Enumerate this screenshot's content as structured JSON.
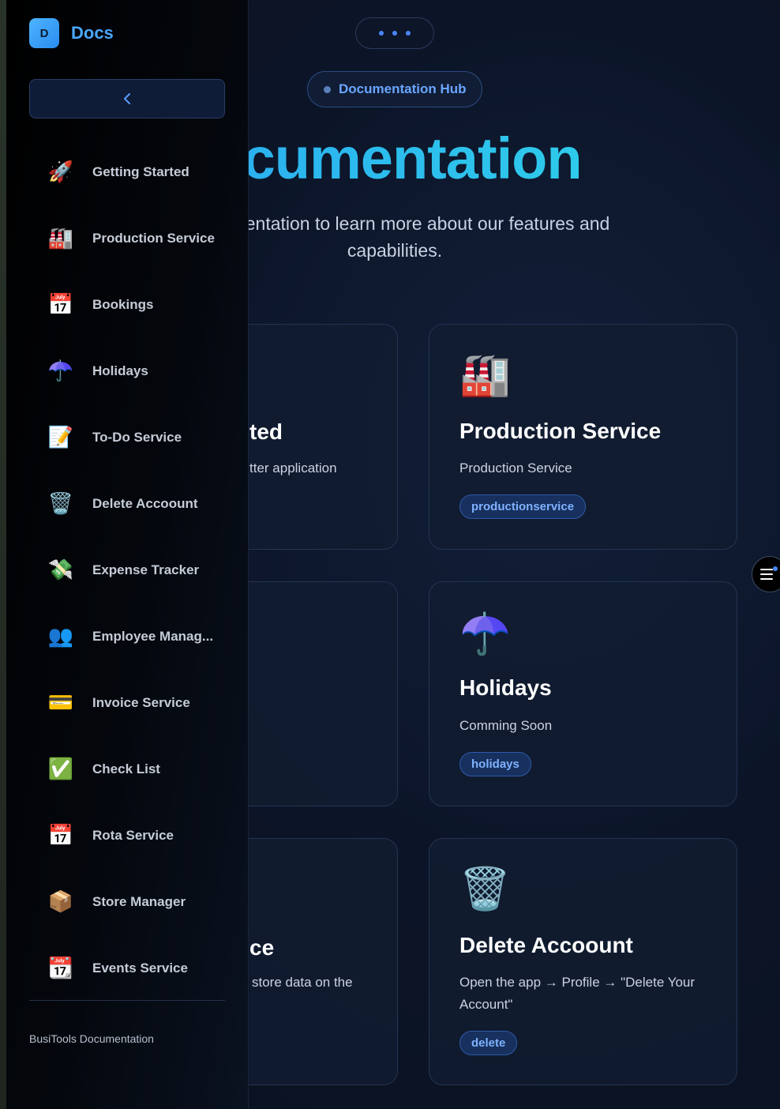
{
  "header": {
    "badge_label": "Documentation Hub",
    "hero_title_fragment": "ocumentation",
    "hero_subtitle_line1": "r documentation to learn more about our features and",
    "hero_subtitle_line2": "capabilities."
  },
  "sidebar": {
    "brand_initial": "D",
    "brand_name": "Docs",
    "items": [
      {
        "icon": "🚀",
        "icon_name": "rocket-icon",
        "label": "Getting Started"
      },
      {
        "icon": "🏭",
        "icon_name": "factory-icon",
        "label": "Production Service"
      },
      {
        "icon": "📅",
        "icon_name": "calendar-icon",
        "label": "Bookings"
      },
      {
        "icon": "☂️",
        "icon_name": "umbrella-icon",
        "label": "Holidays"
      },
      {
        "icon": "📝",
        "icon_name": "memo-icon",
        "label": "To-Do Service"
      },
      {
        "icon": "🗑️",
        "icon_name": "wastebasket-icon",
        "label": "Delete Accoount"
      },
      {
        "icon": "💸",
        "icon_name": "money-wings-icon",
        "label": "Expense Tracker"
      },
      {
        "icon": "👥",
        "icon_name": "people-icon",
        "label": "Employee Manag..."
      },
      {
        "icon": "💳",
        "icon_name": "credit-card-icon",
        "label": "Invoice Service"
      },
      {
        "icon": "✅",
        "icon_name": "check-mark-icon",
        "label": "Check List"
      },
      {
        "icon": "📅",
        "icon_name": "calendar-icon",
        "label": "Rota Service"
      },
      {
        "icon": "📦",
        "icon_name": "package-icon",
        "label": "Store Manager"
      },
      {
        "icon": "📆",
        "icon_name": "tear-off-calendar-icon",
        "label": "Events Service"
      }
    ],
    "footer": "BusiTools Documentation"
  },
  "cards": {
    "left_fragments": [
      {
        "title": "ted",
        "desc": "tter application"
      },
      {
        "title": "",
        "desc": ""
      },
      {
        "title": "ce",
        "desc": "store data on the"
      }
    ],
    "production": {
      "icon": "🏭",
      "title": "Production Service",
      "desc": "Production Service",
      "tag": "productionservice"
    },
    "holidays": {
      "icon": "☂️",
      "title": "Holidays",
      "desc": "Comming Soon",
      "tag": "holidays"
    },
    "delete": {
      "icon": "🗑️",
      "title": "Delete Accoount",
      "desc": "Open the app → Profile → \"Delete Your Account\"",
      "tag": "delete"
    }
  },
  "colors": {
    "accent": "#4aa8ff",
    "title_gradient_start": "#2aa9f0",
    "title_gradient_end": "#2fd0ea",
    "tag_bg": "#17305e"
  }
}
